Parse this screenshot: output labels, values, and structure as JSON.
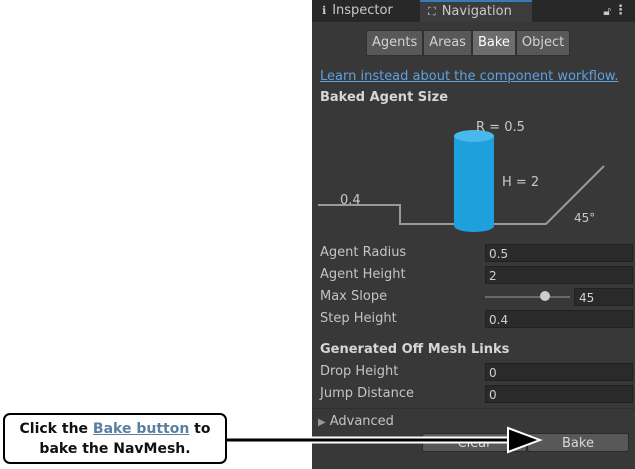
{
  "tabs": [
    {
      "label": "Inspector",
      "icon": "info-icon"
    },
    {
      "label": "Navigation",
      "icon": "navigation-icon"
    }
  ],
  "segments": [
    "Agents",
    "Areas",
    "Bake",
    "Object"
  ],
  "active_segment": "Bake",
  "link_text": "Learn instead about the component workflow.",
  "baked_agent_size": {
    "header": "Baked Agent Size",
    "radius_label": "R = 0.5",
    "height_label": "H = 2",
    "step_label": "0.4",
    "slope_label": "45°"
  },
  "fields": {
    "agent_radius": {
      "label": "Agent Radius",
      "value": "0.5"
    },
    "agent_height": {
      "label": "Agent Height",
      "value": "2"
    },
    "max_slope": {
      "label": "Max Slope",
      "value": "45"
    },
    "step_height": {
      "label": "Step Height",
      "value": "0.4"
    }
  },
  "offmesh": {
    "header": "Generated Off Mesh Links",
    "drop_height": {
      "label": "Drop Height",
      "value": "0"
    },
    "jump_distance": {
      "label": "Jump Distance",
      "value": "0"
    }
  },
  "advanced_label": "Advanced",
  "buttons": {
    "clear": "Clear",
    "bake": "Bake"
  },
  "callout": {
    "before": "Click the",
    "highlight": "Bake button",
    "after": "to",
    "line2": "bake the NavMesh."
  },
  "colors": {
    "panel": "#383838",
    "agent_cylinder": "#1ea0dc",
    "link": "#5ea1e0",
    "active_tab": "#3a79bb"
  }
}
